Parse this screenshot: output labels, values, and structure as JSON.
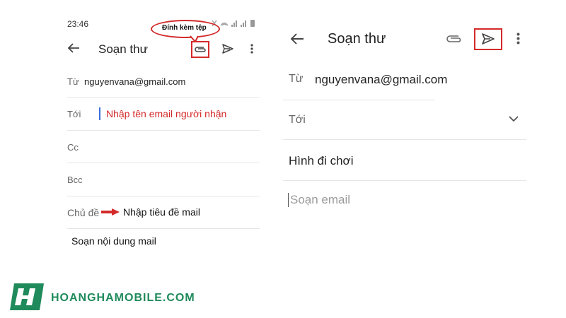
{
  "left": {
    "status_time": "23:46",
    "callout_label": "Đính kèm tệp",
    "title": "Soạn thư",
    "from_label": "Từ",
    "from_value": "nguyenvana@gmail.com",
    "to_label": "Tới",
    "to_hint": "Nhập tên email người nhận",
    "cc_label": "Cc",
    "bcc_label": "Bcc",
    "subject_label": "Chủ đề",
    "subject_hint": "Nhập tiêu đề mail",
    "body_hint": "Soạn nội dung mail"
  },
  "right": {
    "title": "Soạn thư",
    "from_label": "Từ",
    "from_value": "nguyenvana@gmail.com",
    "to_label": "Tới",
    "subject_value": "Hình đi chơi",
    "body_placeholder": "Soạn email"
  },
  "watermark": {
    "text": "HOANGHAMOBILE.COM"
  },
  "colors": {
    "accent_red": "#d42a2a",
    "brand_green": "#1f8a5b",
    "cursor_blue": "#3b6fd8"
  }
}
